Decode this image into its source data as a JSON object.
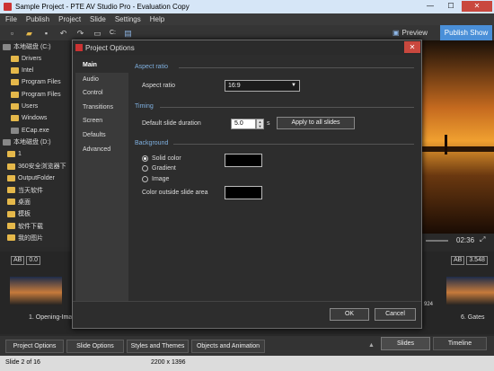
{
  "window": {
    "title": "Sample Project - PTE AV Studio Pro - Evaluation Copy",
    "min": "—",
    "max": "☐",
    "close": "✕"
  },
  "menu": [
    "File",
    "Publish",
    "Project",
    "Slide",
    "Settings",
    "Help"
  ],
  "toolbar": {
    "preview_label": "Preview",
    "publish_label": "Publish Show",
    "drive_label": "C:"
  },
  "tree": {
    "items": [
      {
        "label": "本地磁盘 (C:)",
        "kind": "drive"
      },
      {
        "label": "Drivers",
        "kind": "folder"
      },
      {
        "label": "Intel",
        "kind": "folder"
      },
      {
        "label": "Program Files",
        "kind": "folder"
      },
      {
        "label": "Program Files",
        "kind": "folder"
      },
      {
        "label": "Users",
        "kind": "folder"
      },
      {
        "label": "Windows",
        "kind": "folder"
      },
      {
        "label": "ECap.exe",
        "kind": "file"
      },
      {
        "label": "本地磁盘 (D:)",
        "kind": "drive"
      },
      {
        "label": "1",
        "kind": "folder"
      },
      {
        "label": "360安全浏览器下",
        "kind": "folder"
      },
      {
        "label": "OutputFolder",
        "kind": "folder"
      },
      {
        "label": "当天软件",
        "kind": "folder"
      },
      {
        "label": "桌面",
        "kind": "folder"
      },
      {
        "label": "模板",
        "kind": "folder"
      },
      {
        "label": "软件下载",
        "kind": "folder"
      },
      {
        "label": "我的图片",
        "kind": "folder"
      }
    ]
  },
  "player": {
    "time": "02:36"
  },
  "slides": {
    "left_ab": "AB",
    "left_duration": "0.0",
    "right_ab": "AB",
    "right_duration": "3.548",
    "first_label": "1. Opening-Imag",
    "last_label": "6. Gates",
    "partial_size": "924"
  },
  "bottom_buttons": {
    "project_options": "Project Options",
    "slide_options": "Slide Options",
    "styles_themes": "Styles and Themes",
    "objects_animation": "Objects and Animation",
    "slides_tab": "Slides",
    "timeline_tab": "Timeline"
  },
  "status": {
    "slide": "Slide 2 of 16",
    "resolution": "2200 x 1396"
  },
  "dialog": {
    "title": "Project Options",
    "nav": [
      "Main",
      "Audio",
      "Control",
      "Transitions",
      "Screen",
      "Defaults",
      "Advanced"
    ],
    "aspect_section": "Aspect ratio",
    "aspect_label": "Aspect ratio",
    "aspect_value": "16:9",
    "timing_section": "Timing",
    "duration_label": "Default slide duration",
    "duration_value": "5.0",
    "duration_unit": "s",
    "apply_all": "Apply to all slides",
    "background_section": "Background",
    "solid_color": "Solid color",
    "gradient": "Gradient",
    "image": "Image",
    "outside_color_label": "Color outside slide area",
    "ok": "OK",
    "cancel": "Cancel"
  },
  "colors": {
    "accent": "#4a8fd8",
    "section_title": "#7fb0e0",
    "close_red": "#c9483e"
  }
}
